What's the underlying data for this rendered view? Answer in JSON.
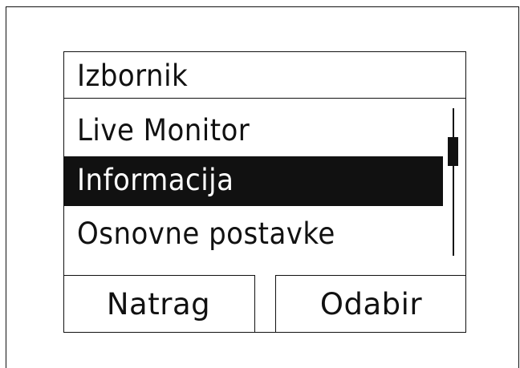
{
  "menu": {
    "title": "Izbornik",
    "items": [
      {
        "label": "Live Monitor",
        "selected": false
      },
      {
        "label": "Informacija",
        "selected": true
      },
      {
        "label": "Osnovne postavke",
        "selected": false
      }
    ],
    "scroll_position": 0.2
  },
  "softkeys": {
    "left_label": "Natrag",
    "right_label": "Odabir"
  }
}
